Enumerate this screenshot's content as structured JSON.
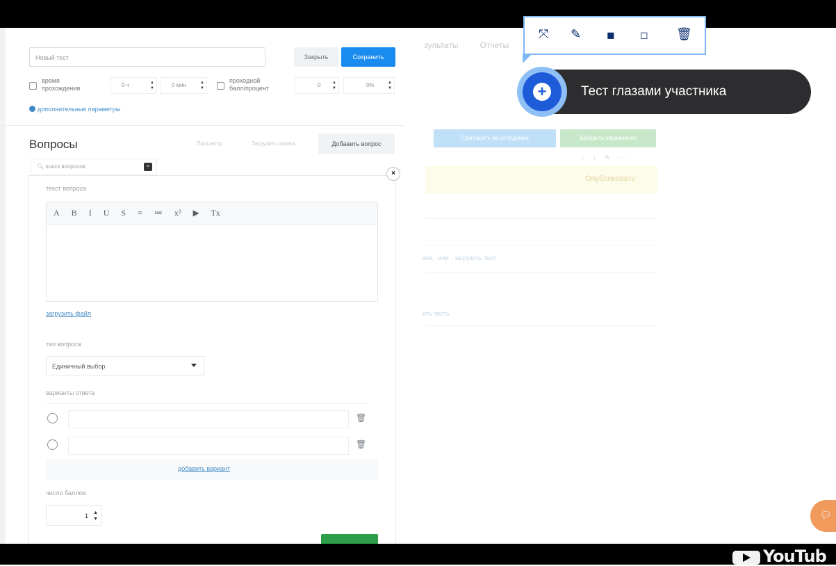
{
  "background": {
    "nav": [
      "зультаты",
      "Отчеты"
    ],
    "blue_btn": "Пригласить на сотрудника",
    "green_btn": "Добавить упражнение",
    "publish": "Опубликовать",
    "link1": "ача · или · загрузить тест",
    "link2": "ить тесть"
  },
  "form": {
    "name_placeholder": "Новый тест",
    "close": "Закрыть",
    "save": "Сохранить",
    "time_label_1": "время",
    "time_label_2": "прохождения",
    "hours": "0 ч",
    "minutes": "0 мин",
    "pass_label_1": "проходной",
    "pass_label_2": "балл/процент",
    "pass_score": "0",
    "pass_percent": "0%",
    "params_link": "дополнительные параметры"
  },
  "questions": {
    "title": "Вопросы",
    "preview": "Просмотр",
    "upload": "Загрузить запись",
    "add": "Добавить вопрос",
    "search_placeholder": "поиск вопросов"
  },
  "editor": {
    "text_label": "текст вопроса",
    "toolbar": [
      "A",
      "B",
      "I",
      "U",
      "S",
      "≡",
      "≔",
      "x²",
      "▶",
      "Tx"
    ],
    "upload_file": "загрузить файл",
    "type_label": "тип вопроса",
    "type_value": "Единичный выбор",
    "answers_label": "варианты ответа",
    "add_variant": "добавить вариант",
    "points_label": "число баллов",
    "points_value": "1"
  },
  "float_toolbar": {
    "icons": [
      "expand-icon",
      "edit-icon",
      "bring-front-icon",
      "send-back-icon",
      "delete-icon"
    ],
    "callout": "Тест глазами участника"
  },
  "branding": {
    "youtube": "YouTub"
  }
}
